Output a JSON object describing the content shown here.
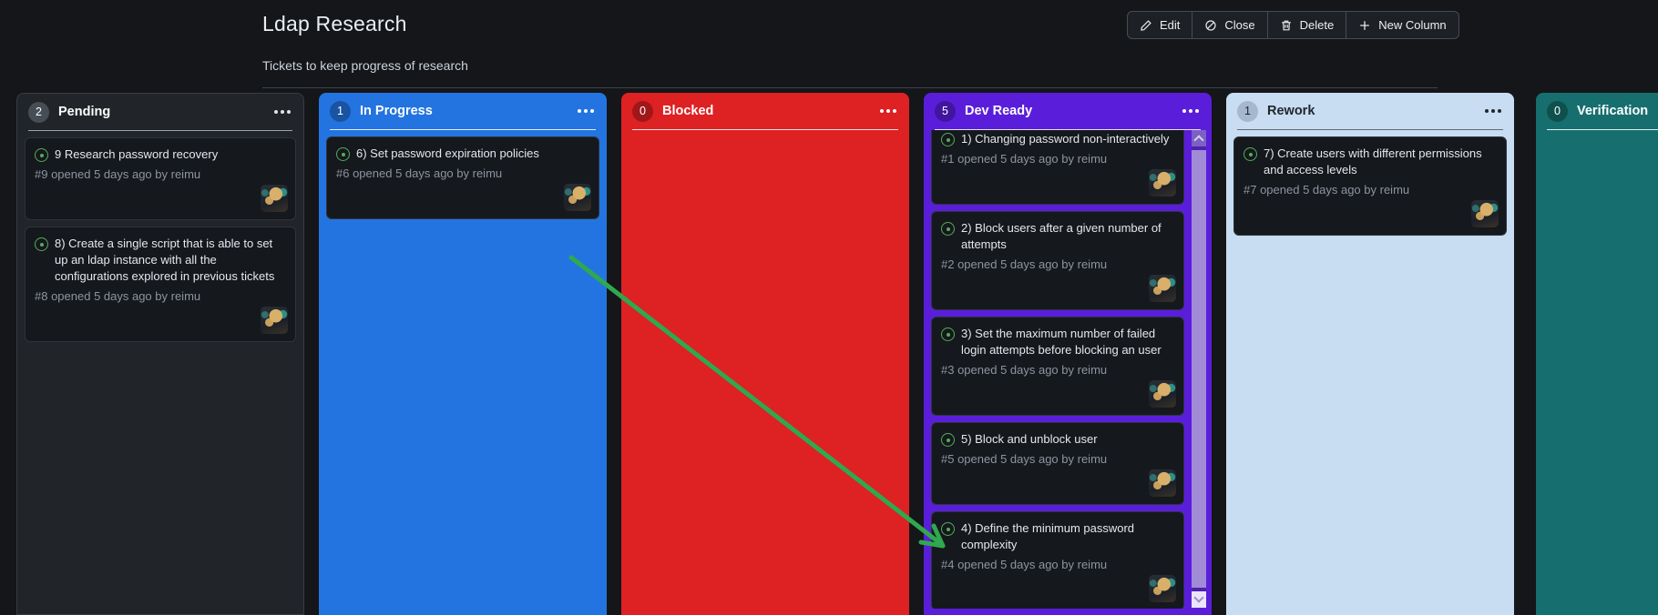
{
  "header": {
    "title": "Ldap Research",
    "subtitle": "Tickets to keep progress of research",
    "buttons": {
      "edit": "Edit",
      "close": "Close",
      "delete": "Delete",
      "new_column": "New Column"
    }
  },
  "columns": [
    {
      "title": "Pending",
      "count": "2",
      "color": "#212529",
      "cards": [
        {
          "title": "9 Research password recovery",
          "meta": "#9 opened 5 days ago by reimu"
        },
        {
          "title": "8) Create a single script that is able to set up an ldap instance with all the configurations explored in previous tickets",
          "meta": "#8 opened 5 days ago by reimu"
        }
      ]
    },
    {
      "title": "In Progress",
      "count": "1",
      "color": "#2374e1",
      "cards": [
        {
          "title": "6) Set password expiration policies",
          "meta": "#6 opened 5 days ago by reimu"
        }
      ]
    },
    {
      "title": "Blocked",
      "count": "0",
      "color": "#de2123",
      "cards": []
    },
    {
      "title": "Dev Ready",
      "count": "5",
      "color": "#5a1edb",
      "cards": [
        {
          "title": "1) Changing password non-interactively",
          "meta": "#1 opened 5 days ago by reimu"
        },
        {
          "title": "2) Block users after a given number of attempts",
          "meta": "#2 opened 5 days ago by reimu"
        },
        {
          "title": "3) Set the maximum number of failed login attempts before blocking an user",
          "meta": "#3 opened 5 days ago by reimu"
        },
        {
          "title": "5) Block and unblock user",
          "meta": "#5 opened 5 days ago by reimu"
        },
        {
          "title": "4) Define the minimum password complexity",
          "meta": "#4 opened 5 days ago by reimu"
        }
      ]
    },
    {
      "title": "Rework",
      "count": "1",
      "color": "#c8ddf2",
      "cards": [
        {
          "title": "7) Create users with different permissions and access levels",
          "meta": "#7 opened 5 days ago by reimu"
        }
      ]
    },
    {
      "title": "Verification",
      "count": "0",
      "color": "#166f6e",
      "cards": []
    }
  ],
  "colors": {
    "issue_open": "#57ab5a"
  },
  "annotation": {
    "arrow_color": "#2fa84f"
  }
}
